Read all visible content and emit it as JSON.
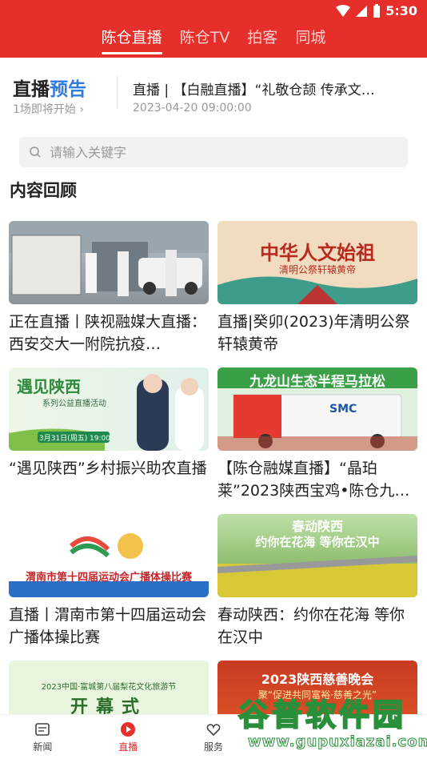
{
  "status_bar": {
    "time": "5:30"
  },
  "top_tabs": [
    {
      "label": "陈仓直播",
      "active": true
    },
    {
      "label": "陈仓TV",
      "active": false
    },
    {
      "label": "拍客",
      "active": false
    },
    {
      "label": "同城",
      "active": false
    }
  ],
  "preview": {
    "label_main": "直播",
    "label_accent": "预告",
    "sub": "1场即将开始 ›",
    "title": "直播 | 【白融直播】“礼敬仓颉 传承文…",
    "time": "2023-04-20 09:00:00"
  },
  "search": {
    "placeholder": "请输入关键字",
    "value": ""
  },
  "section_title": "内容回顾",
  "cards": [
    {
      "caption": "正在直播丨陕视融媒大直播：西安交大一附院抗疫…"
    },
    {
      "caption": "直播|癸卯(2023)年清明公祭轩辕黄帝",
      "thumb_text": "中华人文始祖",
      "thumb_sub": "清明公祭轩辕黄帝"
    },
    {
      "caption": "“遇见陕西”乡村振兴助农直播",
      "thumb_text": "遇见陕西",
      "thumb_sub": "系列公益直播活动",
      "thumb_date": "3月31日(周五) 19:00"
    },
    {
      "caption": "【陈仓融媒直播】“晶珀莱”2023陕西宝鸡•陈仓九…",
      "thumb_text": "九龙山生态半程马拉松",
      "thumb_sub": "SMC"
    },
    {
      "caption": "直播丨渭南市第十四届运动会广播体操比赛",
      "thumb_text": "渭南市第十四届运动会广播体操比赛"
    },
    {
      "caption": "春动陕西：约你在花海 等你在汉中",
      "thumb_text": "春动陕西",
      "thumb_sub": "约你在花海 等你在汉中"
    },
    {
      "caption": "",
      "thumb_text": "开幕式",
      "thumb_sub": "2023中国·富城第八届梨花文化旅游节"
    },
    {
      "caption": "",
      "thumb_text": "2023陕西慈善晚会",
      "thumb_sub": "聚“促进共同富裕·慈善之光”"
    }
  ],
  "bottom_tabs": [
    {
      "label": "新闻",
      "icon": "news-icon",
      "active": false
    },
    {
      "label": "直播",
      "icon": "live-icon",
      "active": true
    },
    {
      "label": "服务",
      "icon": "service-icon",
      "active": false
    },
    {
      "label": "",
      "icon": "placeholder",
      "active": false
    },
    {
      "label": "",
      "icon": "placeholder",
      "active": false
    }
  ],
  "watermark": {
    "big": "谷普软件园",
    "small": "www.gupuxiazai.com"
  },
  "colors": {
    "brand": "#e62f2a",
    "accent": "#2f7be0"
  }
}
